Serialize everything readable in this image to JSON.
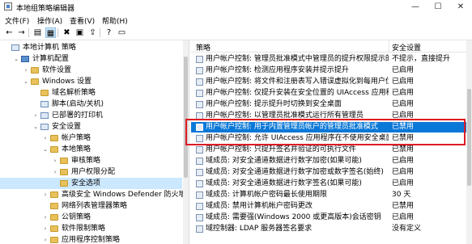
{
  "window": {
    "title": "本地组策略编辑器",
    "minimize": "—",
    "maximize": "☐",
    "close": "✕"
  },
  "menu": [
    "文件(F)",
    "操作(A)",
    "查看(V)",
    "帮助(H)"
  ],
  "toolbar": {
    "buttons": [
      {
        "name": "back-arrow-icon",
        "glyph": "←"
      },
      {
        "name": "forward-arrow-icon",
        "glyph": "→"
      },
      {
        "name": "up-folder-icon",
        "glyph": "▤"
      },
      {
        "name": "show-hide-tree-icon",
        "glyph": "▦"
      },
      {
        "name": "delete-icon",
        "glyph": "✖"
      },
      {
        "name": "properties-icon",
        "glyph": "▣"
      },
      {
        "name": "export-list-icon",
        "glyph": "⇪"
      },
      {
        "name": "help-icon",
        "glyph": "?"
      },
      {
        "name": "console-icon",
        "glyph": "▭"
      }
    ]
  },
  "tree": {
    "items": [
      {
        "label": "本地计算机 策略",
        "level": 0,
        "chev": "",
        "icon": "policy"
      },
      {
        "label": "计算机配置",
        "level": 1,
        "chev": "⌄",
        "icon": "pc"
      },
      {
        "label": "软件设置",
        "level": 2,
        "chev": "›",
        "icon": "folder"
      },
      {
        "label": "Windows 设置",
        "level": 2,
        "chev": "⌄",
        "icon": "folder"
      },
      {
        "label": "域名解析策略",
        "level": 3,
        "chev": "",
        "icon": "folder"
      },
      {
        "label": "脚本(启动/关机)",
        "level": 3,
        "chev": "",
        "icon": "policy"
      },
      {
        "label": "已部署的打印机",
        "level": 3,
        "chev": "›",
        "icon": "policy"
      },
      {
        "label": "安全设置",
        "level": 3,
        "chev": "⌄",
        "icon": "policy"
      },
      {
        "label": "帐户策略",
        "level": 4,
        "chev": "›",
        "icon": "folder"
      },
      {
        "label": "本地策略",
        "level": 4,
        "chev": "⌄",
        "icon": "folder"
      },
      {
        "label": "审核策略",
        "level": 5,
        "chev": "›",
        "icon": "folder"
      },
      {
        "label": "用户权限分配",
        "level": 5,
        "chev": "›",
        "icon": "folder"
      },
      {
        "label": "安全选项",
        "level": 5,
        "chev": "",
        "icon": "folder",
        "selected": true
      },
      {
        "label": "高级安全 Windows Defender 防火墙",
        "level": 4,
        "chev": "›",
        "icon": "folder"
      },
      {
        "label": "网络列表管理器策略",
        "level": 4,
        "chev": "",
        "icon": "folder"
      },
      {
        "label": "公钥策略",
        "level": 4,
        "chev": "›",
        "icon": "folder"
      },
      {
        "label": "软件限制策略",
        "level": 4,
        "chev": "›",
        "icon": "folder"
      },
      {
        "label": "应用程序控制策略",
        "level": 4,
        "chev": "›",
        "icon": "folder"
      }
    ]
  },
  "list": {
    "col_policy": "策略",
    "col_setting": "安全设置",
    "rows": [
      {
        "name": "用户帐户控制: 管理员批准模式中管理员的提升权限提示的...",
        "value": "不提示，直接提升"
      },
      {
        "name": "用户帐户控制: 检测应用程序安装并提示提升",
        "value": "已启用"
      },
      {
        "name": "用户帐户控制: 将文件和注册表写入错误虚拟化到每用户位置",
        "value": "已启用"
      },
      {
        "name": "用户帐户控制: 仅提升安装在安全位置的 UIAccess 应用程序",
        "value": "已启用"
      },
      {
        "name": "用户帐户控制: 提示提升时切换到安全桌面",
        "value": "已启用"
      },
      {
        "name": "用户帐户控制: 以管理员批准模式运行所有管理员",
        "value": "已启用"
      },
      {
        "name": "用户帐户控制: 用于内置管理员帐户的管理员批准模式",
        "value": "已禁用",
        "selected": true
      },
      {
        "name": "用户帐户控制: 允许 UIAccess 应用程序在不使用安全桌面...",
        "value": "已禁用"
      },
      {
        "name": "用户帐户控制: 只提升签名并验证的可执行文件",
        "value": "已禁用"
      },
      {
        "name": "域成员: 对安全通道数据进行数字加密(如果可能)",
        "value": "已启用"
      },
      {
        "name": "域成员: 对安全通道数据进行数字加密或数字签名(始终)",
        "value": "已启用"
      },
      {
        "name": "域成员: 对安全通道数据进行数字签名(如果可能)",
        "value": "已启用"
      },
      {
        "name": "域成员: 计算机帐户密码最长使用期限",
        "value": "30 天"
      },
      {
        "name": "域成员: 禁用计算机帐户密码更改",
        "value": "已禁用"
      },
      {
        "name": "域成员: 需要强(Windows 2000 或更高版本)会话密钥",
        "value": "已启用"
      },
      {
        "name": "域控制器: LDAP 服务器签名要求",
        "value": "没有定义"
      }
    ]
  }
}
